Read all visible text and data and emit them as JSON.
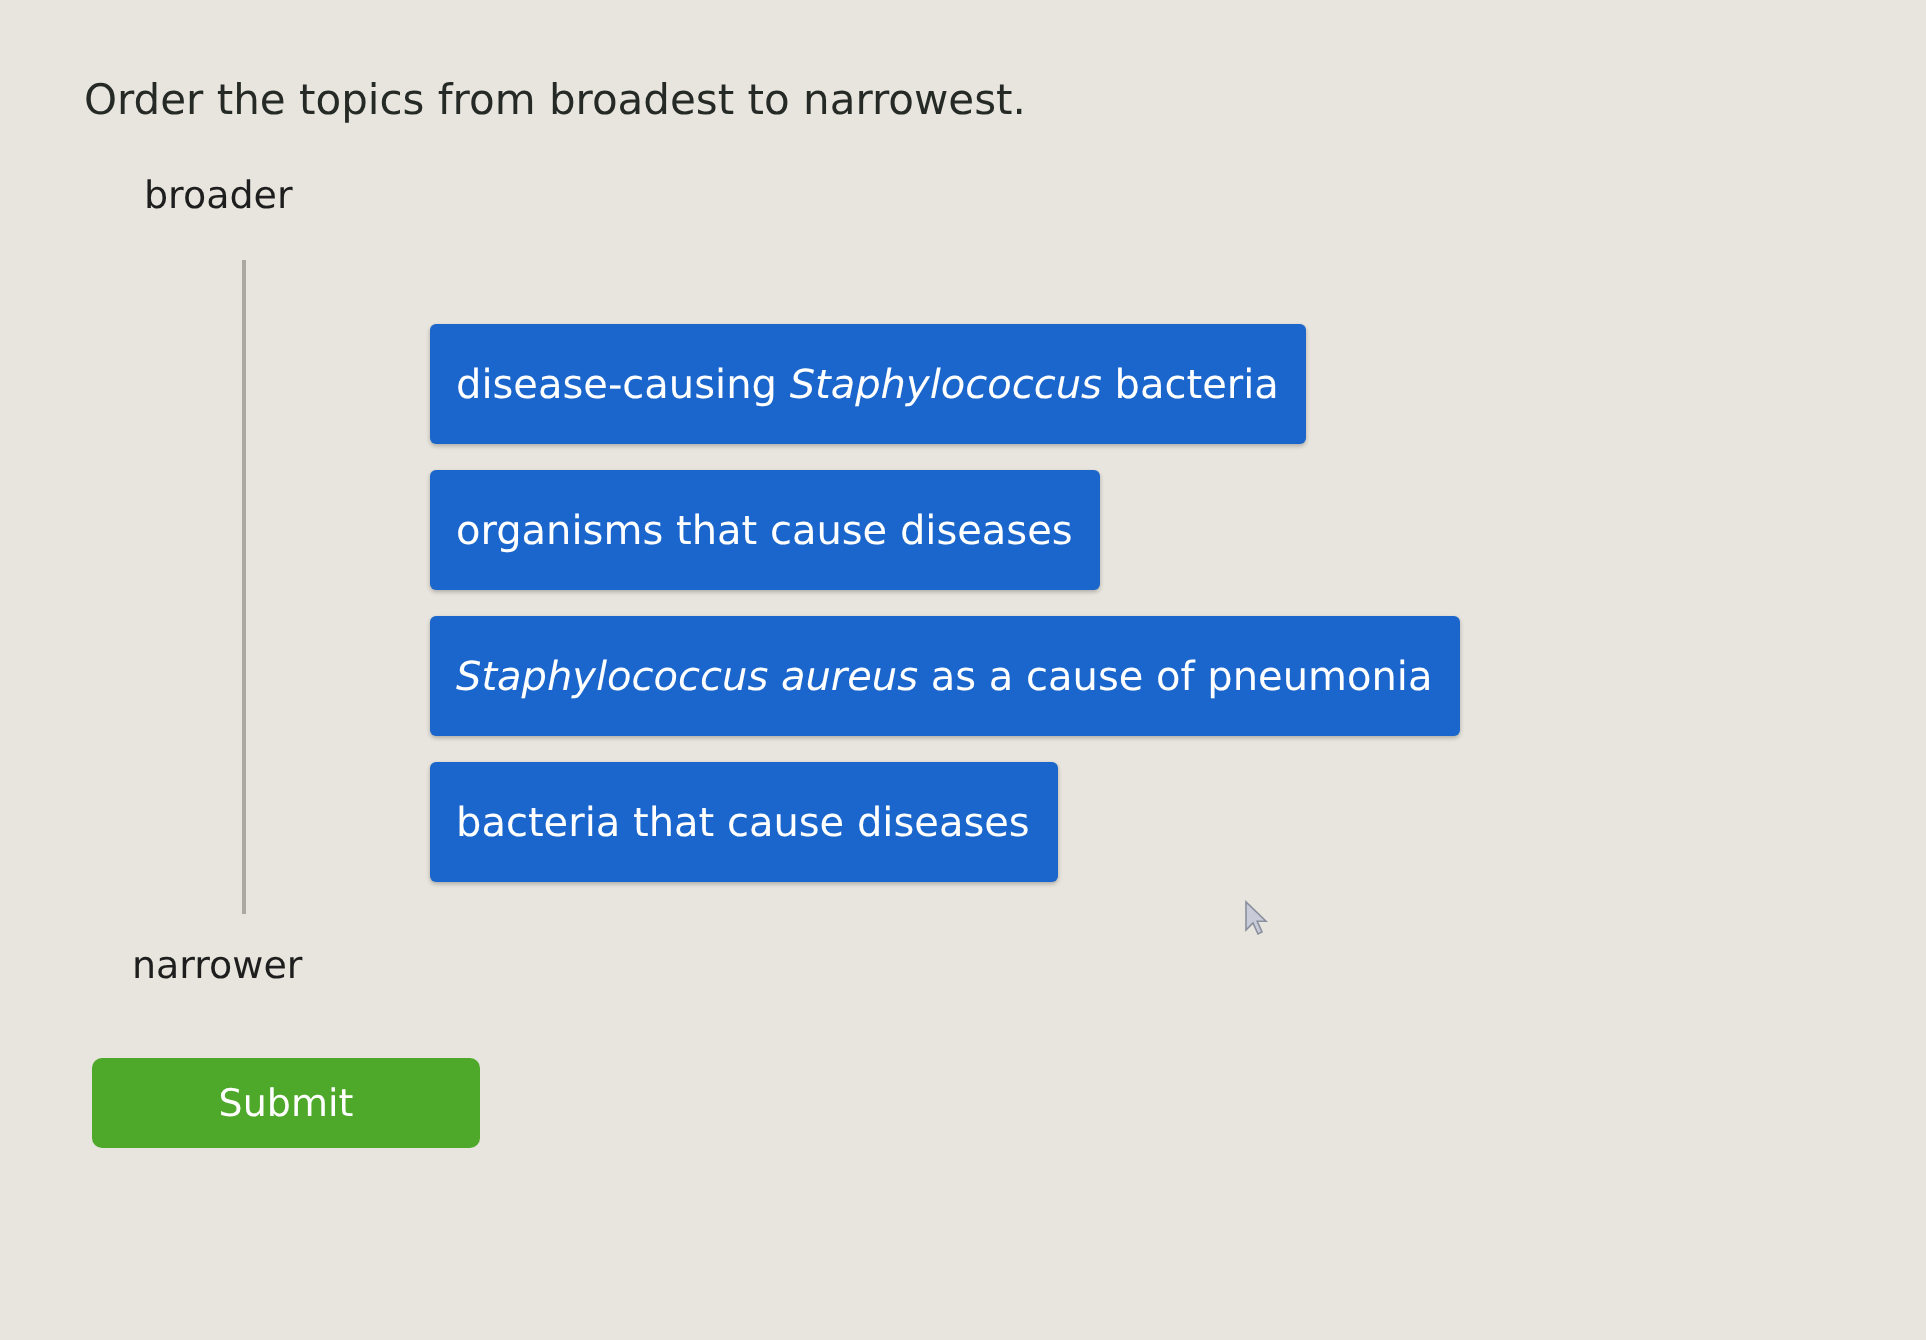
{
  "prompt": "Order the topics from broadest to narrowest.",
  "scale": {
    "top_label": "broader",
    "bottom_label": "narrower"
  },
  "items": [
    {
      "text": "disease-causing *Staphylococcus* bacteria"
    },
    {
      "text": "organisms that cause diseases"
    },
    {
      "text": "*Staphylococcus aureus* as a cause of pneumonia"
    },
    {
      "text": "bacteria that cause diseases"
    }
  ],
  "submit_button": {
    "label": "Submit"
  }
}
